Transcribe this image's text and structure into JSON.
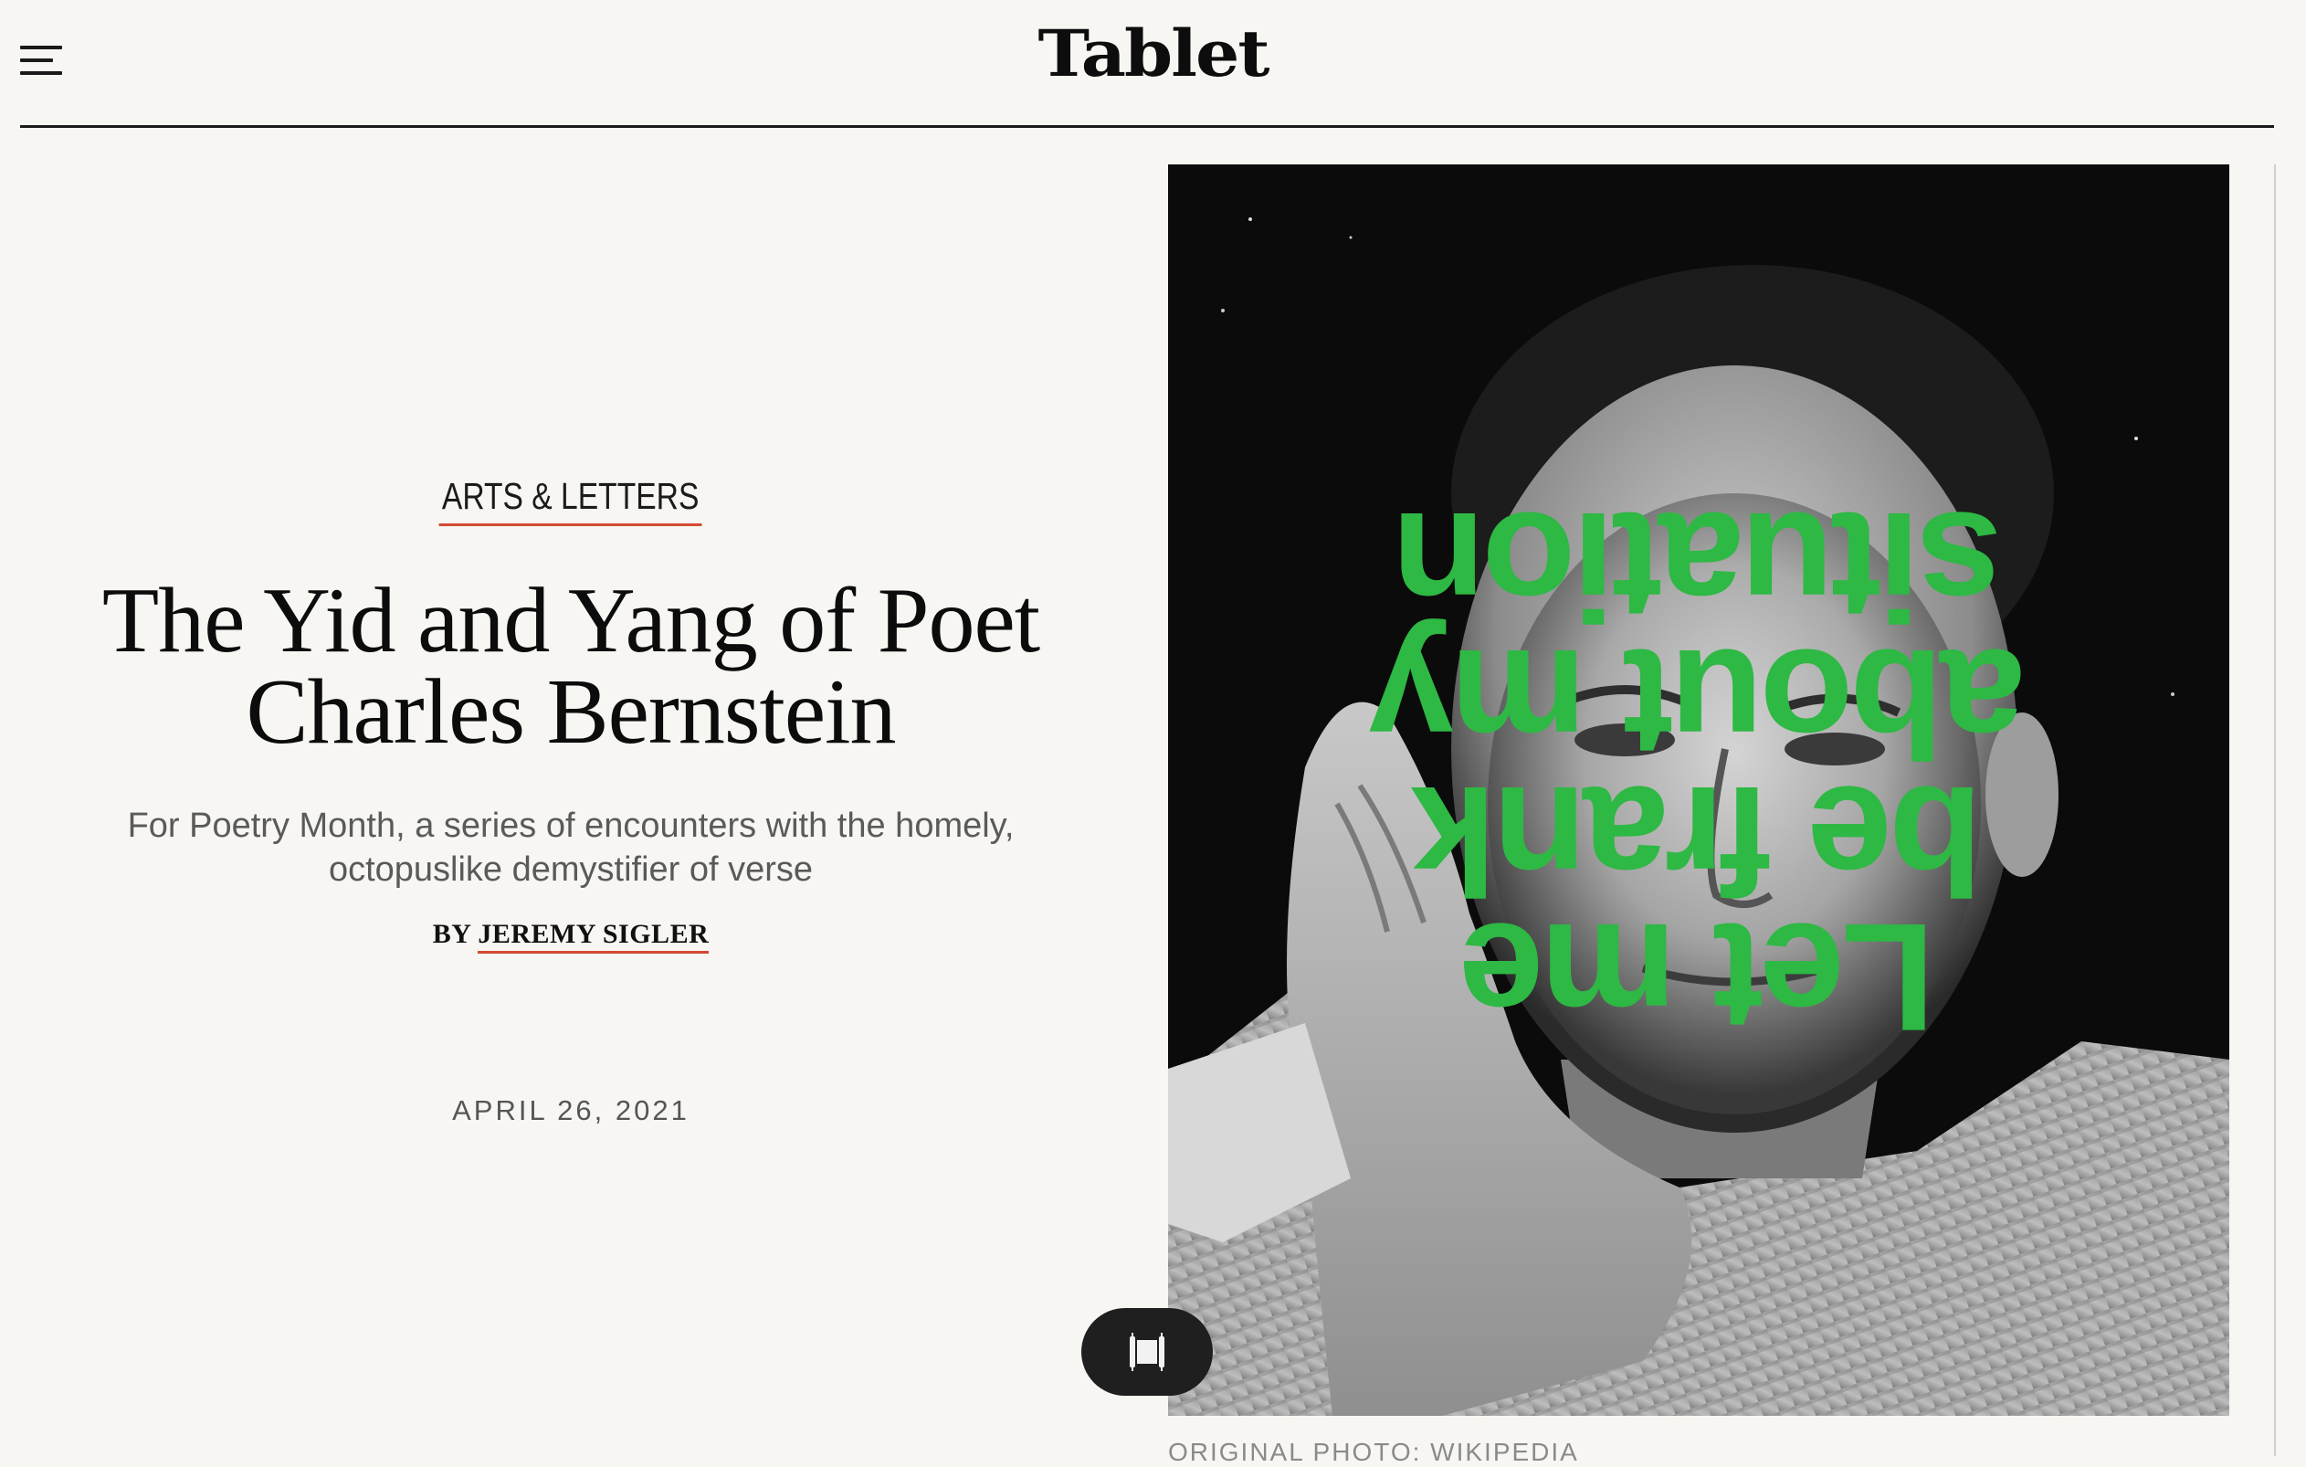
{
  "header": {
    "menu_icon": "hamburger-menu-icon",
    "logo": "Tablet"
  },
  "article": {
    "kicker": "ARTS & LETTERS",
    "title_line1": "The Yid and Yang of Poet",
    "title_line2": "Charles Bernstein",
    "dek_line1": "For Poetry Month, a series of encounters with the homely,",
    "dek_line2": "octopuslike demystifier of verse",
    "byline_prefix": "BY",
    "author": "JEREMY SIGLER",
    "date": "APRIL 26, 2021"
  },
  "hero": {
    "overlay_lines": [
      "Let me",
      "be frank",
      "about my",
      "situation"
    ],
    "overlay_color": "#2eb844",
    "caption": "ORIGINAL PHOTO: WIKIPEDIA"
  },
  "floating_button": {
    "icon": "scroll-torah-icon"
  },
  "colors": {
    "background": "#f7f6f2",
    "accent_underline": "#d24a2f"
  }
}
